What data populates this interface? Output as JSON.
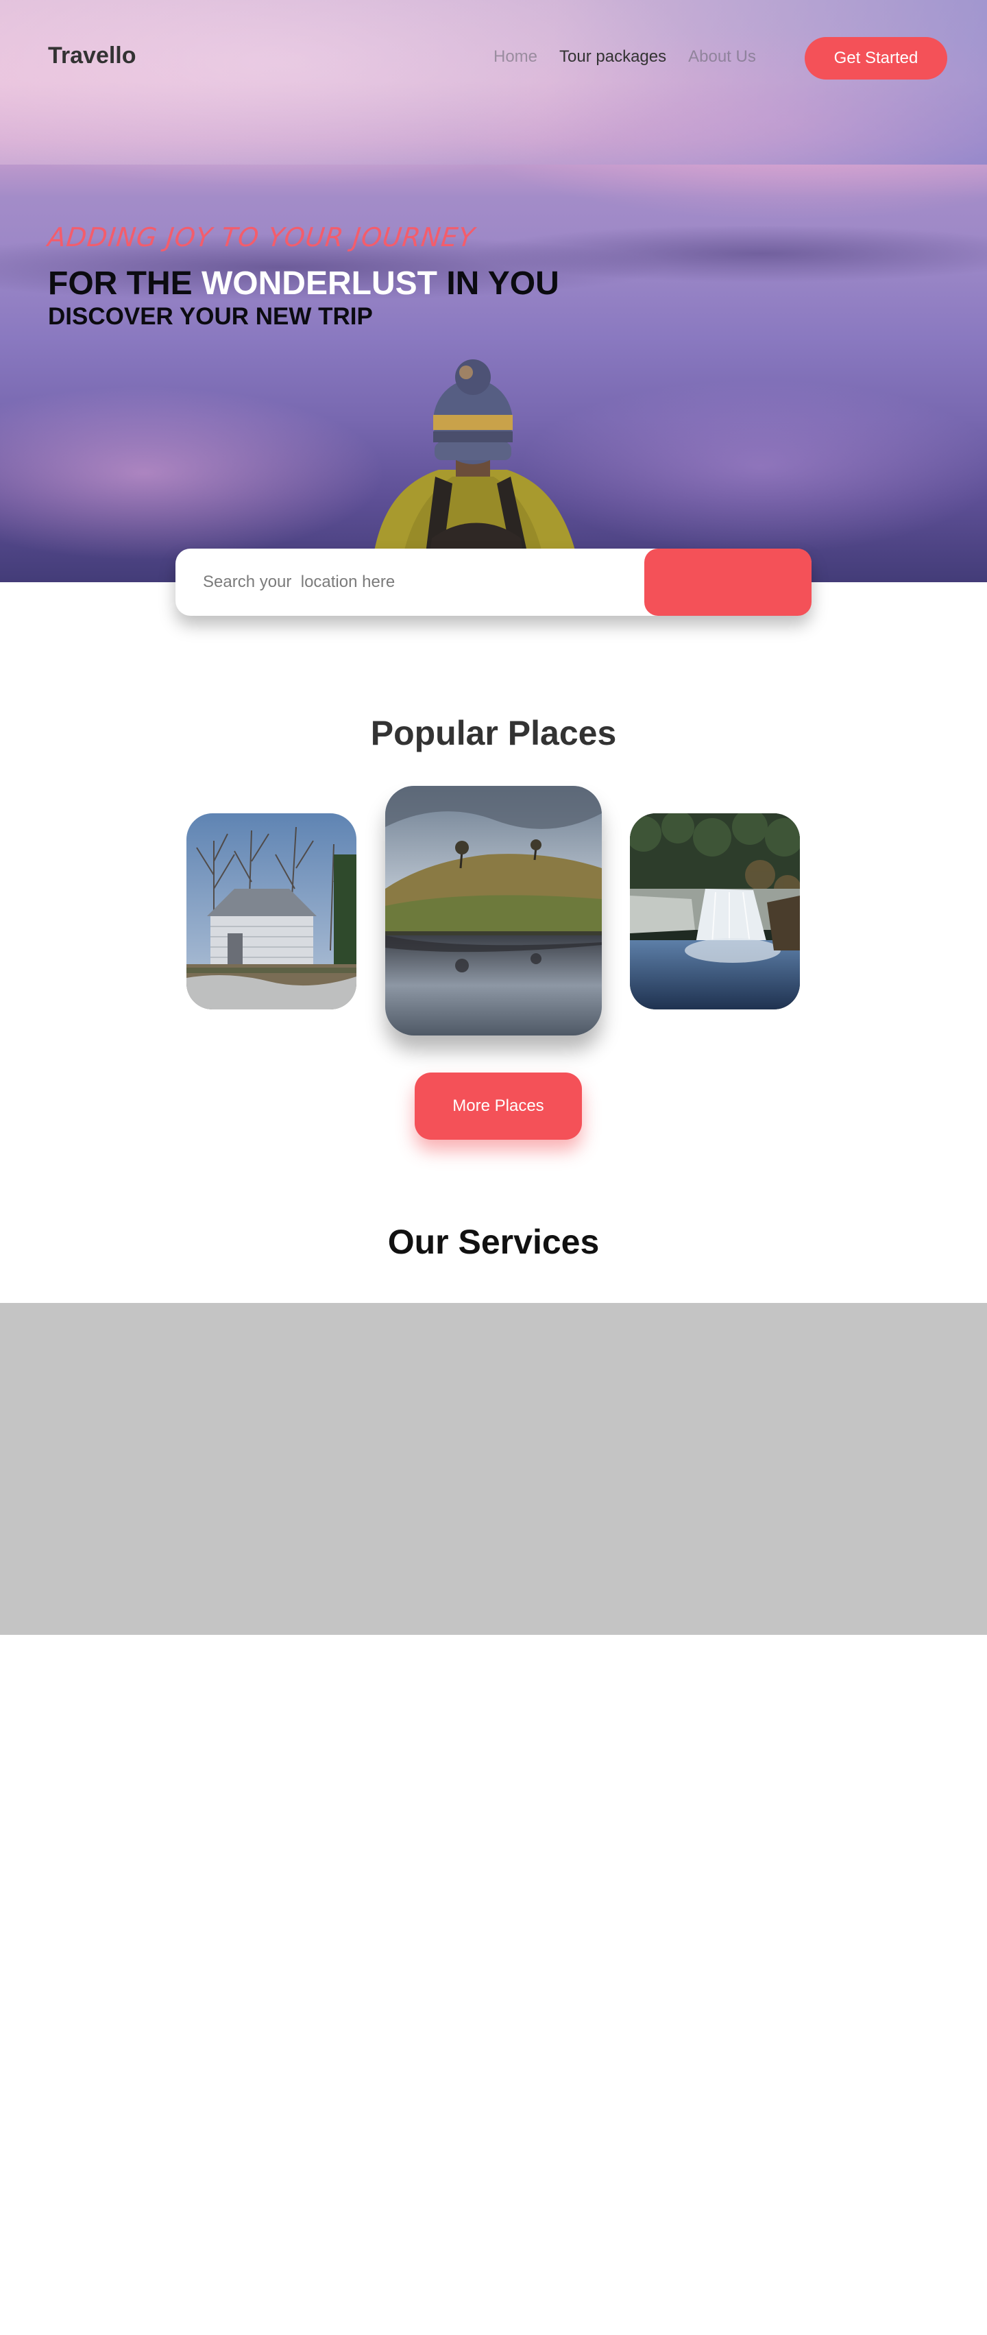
{
  "nav": {
    "logo": "Travello",
    "links": [
      "Home",
      "Tour packages",
      "About Us"
    ],
    "cta": "Get Started"
  },
  "hero": {
    "tagline": "ADDING JOY TO YOUR JOURNEY",
    "headline_prefix": "FOR THE",
    "headline_highlight": "WONDERLUST",
    "headline_suffix": "IN YOU",
    "subheadline": "DISCOVER YOUR NEW TRIP"
  },
  "search": {
    "placeholder": "Search your  location here",
    "button_label": ""
  },
  "popular": {
    "title": "Popular Places",
    "places": [
      {
        "image": "barn-in-winter-field"
      },
      {
        "image": "hill-with-trees-reflection"
      },
      {
        "image": "waterfall-in-forest"
      }
    ],
    "more_button": "More Places"
  },
  "services": {
    "title": "Our Services"
  },
  "colors": {
    "accent": "#f45158",
    "tagline": "#f35d6c",
    "services_block": "#c4c4c4"
  }
}
